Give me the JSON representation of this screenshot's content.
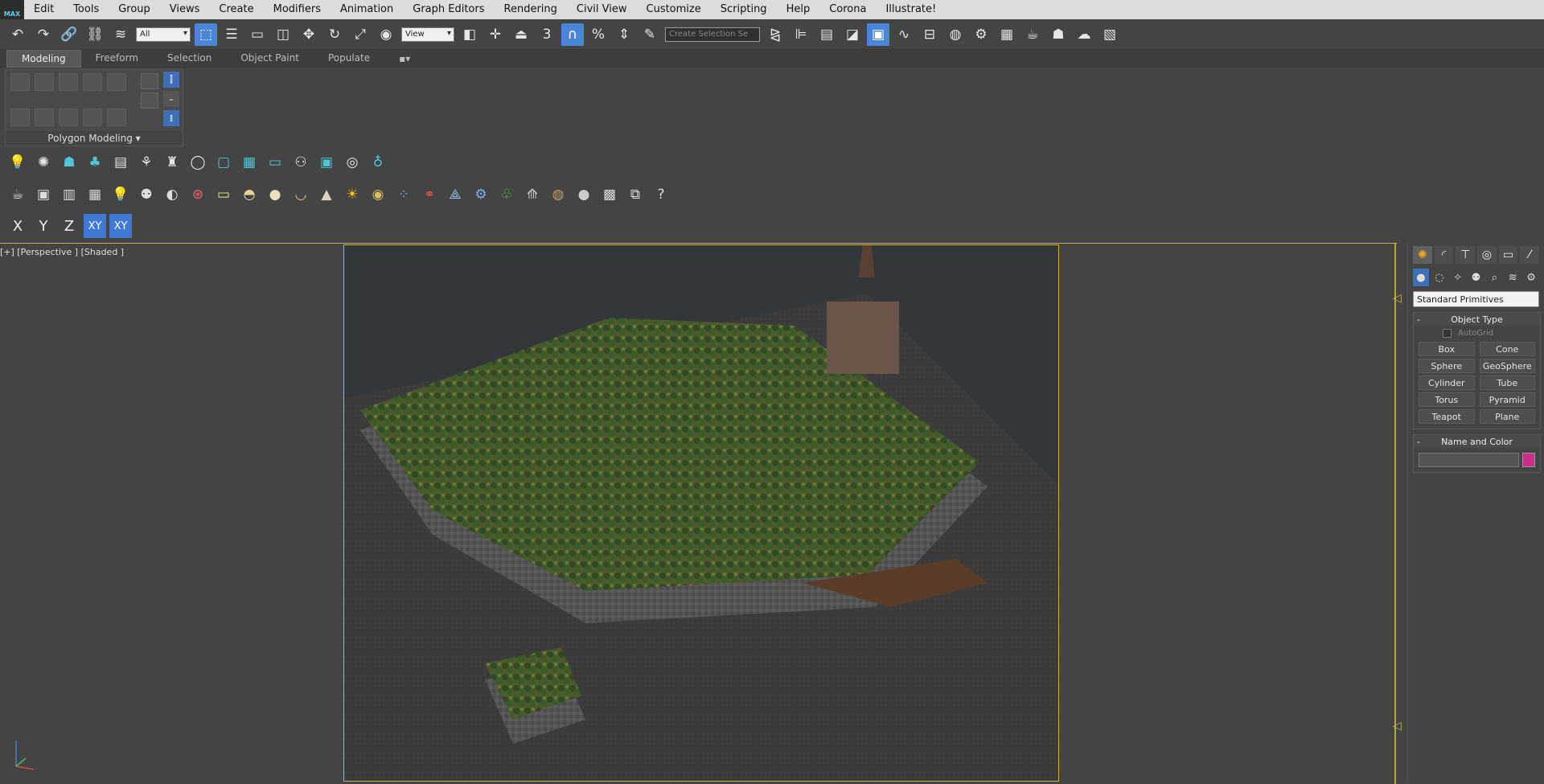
{
  "menu": {
    "logo": "MAX",
    "items": [
      "Edit",
      "Tools",
      "Group",
      "Views",
      "Create",
      "Modifiers",
      "Animation",
      "Graph Editors",
      "Rendering",
      "Civil View",
      "Customize",
      "Scripting",
      "Help",
      "Corona",
      "Illustrate!"
    ]
  },
  "toolbar": {
    "filter_select": "All",
    "ref_coord_select": "View",
    "snap_label": "3",
    "percent_snap": "%",
    "named_sel": "Create Selection Se"
  },
  "ribbon": {
    "tabs": [
      "Modeling",
      "Freeform",
      "Selection",
      "Object Paint",
      "Populate"
    ],
    "active_tab": "Modeling",
    "panel_label": "Polygon Modeling"
  },
  "axis": {
    "x": "X",
    "y": "Y",
    "z": "Z",
    "xy": "XY",
    "xy_snap": "XY"
  },
  "viewport": {
    "label": "[+] [Perspective ] [Shaded ]"
  },
  "command_panel": {
    "category_dropdown": "Standard Primitives",
    "object_type_title": "Object Type",
    "autogrid_label": "AutoGrid",
    "primitives": [
      "Box",
      "Cone",
      "Sphere",
      "GeoSphere",
      "Cylinder",
      "Tube",
      "Torus",
      "Pyramid",
      "Teapot",
      "Plane"
    ],
    "name_color_title": "Name and Color",
    "object_color": "#cc2d8c"
  }
}
